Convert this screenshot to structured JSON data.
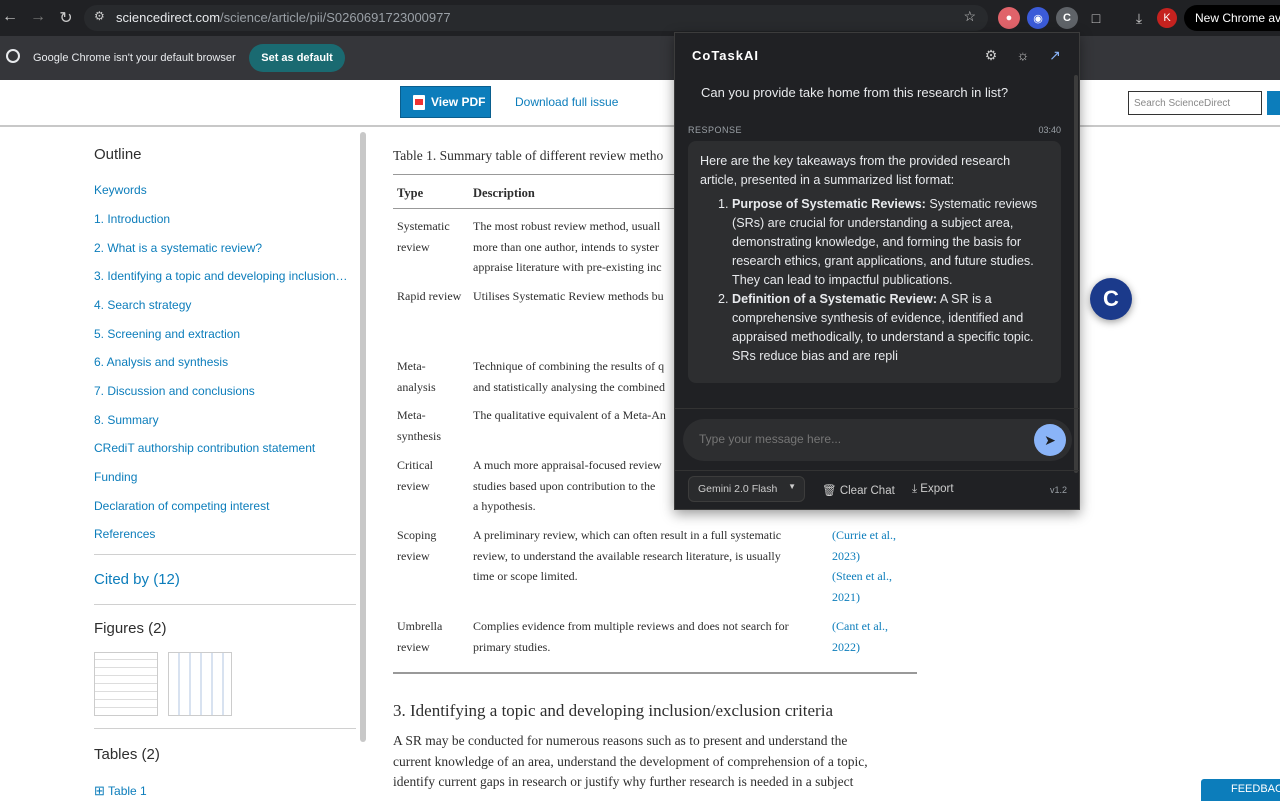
{
  "browser": {
    "url_host": "sciencedirect.com",
    "url_path": "/science/article/pii/S0260691723000977",
    "new_chrome": "New Chrome avai",
    "profile_initial": "K"
  },
  "infobar": {
    "message": "Google Chrome isn't your default browser",
    "set_default": "Set as default"
  },
  "site": {
    "view_pdf": "View PDF",
    "download_issue": "Download full issue",
    "search_placeholder": "Search ScienceDirect"
  },
  "outline": {
    "title": "Outline",
    "items": [
      "Keywords",
      "1. Introduction",
      "2. What is a systematic review?",
      "3. Identifying a topic and developing inclusion…",
      "4. Search strategy",
      "5. Screening and extraction",
      "6. Analysis and synthesis",
      "7. Discussion and conclusions",
      "8. Summary",
      "CRediT authorship contribution statement",
      "Funding",
      "Declaration of competing interest",
      "References"
    ],
    "cited_by": "Cited by (12)",
    "figures": "Figures (2)",
    "tables": "Tables (2)",
    "table1": "Table 1"
  },
  "article": {
    "table_caption": "Table 1. Summary table of different review metho",
    "col_type": "Type",
    "col_desc": "Description",
    "rows": [
      {
        "type": [
          "Systematic",
          "review"
        ],
        "desc": [
          "The most robust review method, usuall",
          "more than one author, intends to syster",
          "appraise literature with pre-existing inc"
        ],
        "refs": []
      },
      {
        "type": [
          "Rapid review"
        ],
        "desc": [
          "Utilises Systematic Review methods bu"
        ],
        "refs": []
      },
      {
        "type": [
          "Meta-",
          "analysis"
        ],
        "desc": [
          "Technique of combining the results of q",
          "and statistically analysing the combined"
        ],
        "refs": []
      },
      {
        "type": [
          "Meta-",
          "synthesis"
        ],
        "desc": [
          "The qualitative equivalent of a Meta-An"
        ],
        "refs": []
      },
      {
        "type": [
          "Critical",
          "review"
        ],
        "desc": [
          "A much more appraisal-focused review",
          "studies based upon contribution to the",
          "a hypothesis."
        ],
        "refs": []
      },
      {
        "type": [
          "Scoping",
          "review"
        ],
        "desc": [
          "A preliminary review, which can often result in a full systematic",
          "review, to understand the available research literature, is usually",
          "time or scope limited."
        ],
        "refs": [
          "(Currie et al.,",
          "2023)",
          "(Steen et al.,",
          "2021)"
        ]
      },
      {
        "type": [
          "Umbrella",
          "review"
        ],
        "desc": [
          "Complies evidence from multiple reviews and does not search for",
          "primary studies."
        ],
        "refs": [
          "(Cant et al.,",
          "2022)"
        ]
      }
    ],
    "section_heading": "3. Identifying a topic and developing inclusion/exclusion criteria",
    "body_lines": [
      "A SR may be conducted for numerous reasons such as to present and understand the",
      "current knowledge of an area, understand the development of comprehension of a topic,",
      "identify current gaps in research or justify why further research is needed in a subject"
    ]
  },
  "cotask": {
    "title": "CoTaskAI",
    "question": "Can you provide take home from this research in list?",
    "response_label": "RESPONSE",
    "response_time": "03:40",
    "intro": "Here are the key takeaways from the provided research article, presented in a summarized list format:",
    "points": [
      {
        "bold": "Purpose of Systematic Reviews:",
        "text": " Systematic reviews (SRs) are crucial for understanding a subject area, demonstrating knowledge, and forming the basis for research ethics, grant applications, and future studies. They can lead to impactful publications."
      },
      {
        "bold": "Definition of a Systematic Review:",
        "text": " A SR is a comprehensive synthesis of evidence, identified and appraised methodically, to understand a specific topic. SRs reduce bias and are repli"
      }
    ],
    "input_placeholder": "Type your message here...",
    "model": "Gemini 2.0 Flash",
    "clear_chat": "Clear Chat",
    "export": "Export",
    "version": "v1.2",
    "fab_letter": "C"
  },
  "feedback": "FEEDBAC"
}
